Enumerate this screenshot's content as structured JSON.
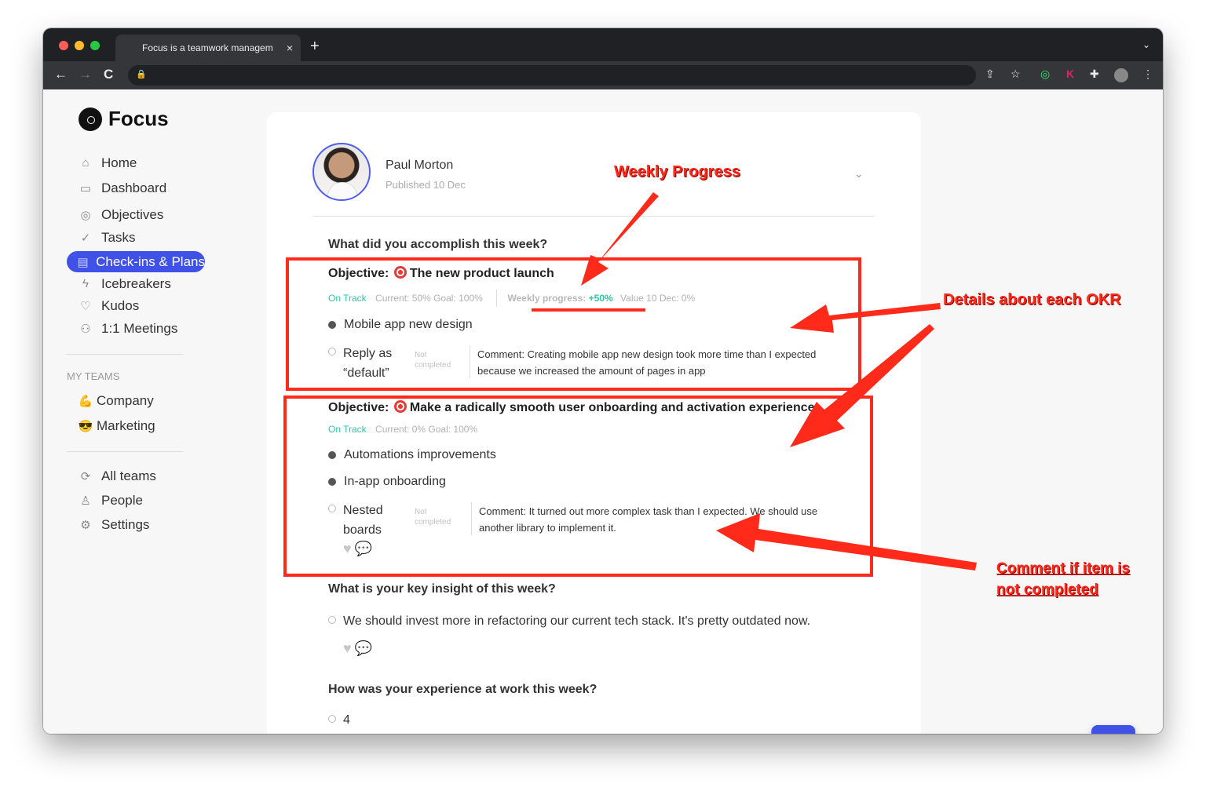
{
  "browser": {
    "tab_title": "Focus is a teamwork managem",
    "tab_close": "×",
    "new_tab": "+",
    "tab_menu": "⌄",
    "back": "←",
    "forward": "→",
    "reload": "C",
    "lock": "🔒"
  },
  "sidebar": {
    "logo": "Focus",
    "nav": [
      {
        "label": "Home",
        "icon": "home-icon",
        "glyph": "⌂"
      },
      {
        "label": "Dashboard",
        "icon": "dashboard-icon",
        "glyph": "▭"
      },
      {
        "label": "Objectives",
        "icon": "objectives-icon",
        "glyph": "◎"
      },
      {
        "label": "Tasks",
        "icon": "tasks-icon",
        "glyph": "✓"
      },
      {
        "label": "Check-ins & Plans",
        "icon": "checkins-icon",
        "glyph": "▤"
      },
      {
        "label": "Icebreakers",
        "icon": "icebreakers-icon",
        "glyph": "ϟ"
      },
      {
        "label": "Kudos",
        "icon": "kudos-icon",
        "glyph": "♡"
      },
      {
        "label": "1:1 Meetings",
        "icon": "meetings-icon",
        "glyph": "⚇"
      }
    ],
    "teams_label": "MY TEAMS",
    "teams": [
      {
        "label": "Company",
        "emoji": "💪"
      },
      {
        "label": "Marketing",
        "emoji": "😎"
      }
    ],
    "footer": [
      {
        "label": "All teams",
        "icon": "all-teams-icon",
        "glyph": "⟳"
      },
      {
        "label": "People",
        "icon": "people-icon",
        "glyph": "♙"
      },
      {
        "label": "Settings",
        "icon": "settings-icon",
        "glyph": "⚙"
      }
    ]
  },
  "checkin": {
    "author": "Paul Morton",
    "published": "Published 10 Dec",
    "q1": "What did you accomplish this week?",
    "objective1": {
      "prefix": "Objective:",
      "title": "The new product launch",
      "status": "On Track",
      "current": "Current: 50%",
      "goal": "Goal: 100%",
      "weekly_label": "Weekly progress:",
      "weekly_value": "+50%",
      "value_text": "Value 10 Dec: 0%",
      "item1": "Mobile app new design",
      "item2_line1": "Reply as",
      "item2_line2": "“default”",
      "item2_status_1": "Not",
      "item2_status_2": "completed",
      "comment_line1": "Comment: Creating mobile app new design took more time than I expected",
      "comment_line2": "because we increased the amount of pages in app"
    },
    "objective2": {
      "prefix": "Objective:",
      "title": "Make a radically smooth user onboarding and activation experience",
      "status": "On Track",
      "current": "Current: 0%",
      "goal": "Goal: 100%",
      "item1": "Automations improvements",
      "item2": "In-app onboarding",
      "item3_line1": "Nested",
      "item3_line2": "boards",
      "item3_status_1": "Not",
      "item3_status_2": "completed",
      "comment_line1": "Comment: It turned out more complex task than I expected. We should use",
      "comment_line2": "another library to implement it."
    },
    "q2": "What is your key insight of this week?",
    "insight": "We should invest more in refactoring our current tech stack. It's pretty outdated now.",
    "q3": "How was your experience at work this week?",
    "experience": "4"
  },
  "annotations": {
    "weekly_progress": "Weekly Progress",
    "details_okr": "Details about each OKR",
    "comment_1": "Comment if item is",
    "comment_2": "not completed",
    "color": "#ff2a1a"
  },
  "colors": {
    "accent": "#3f51e6",
    "on_track": "#2ec4a3"
  }
}
